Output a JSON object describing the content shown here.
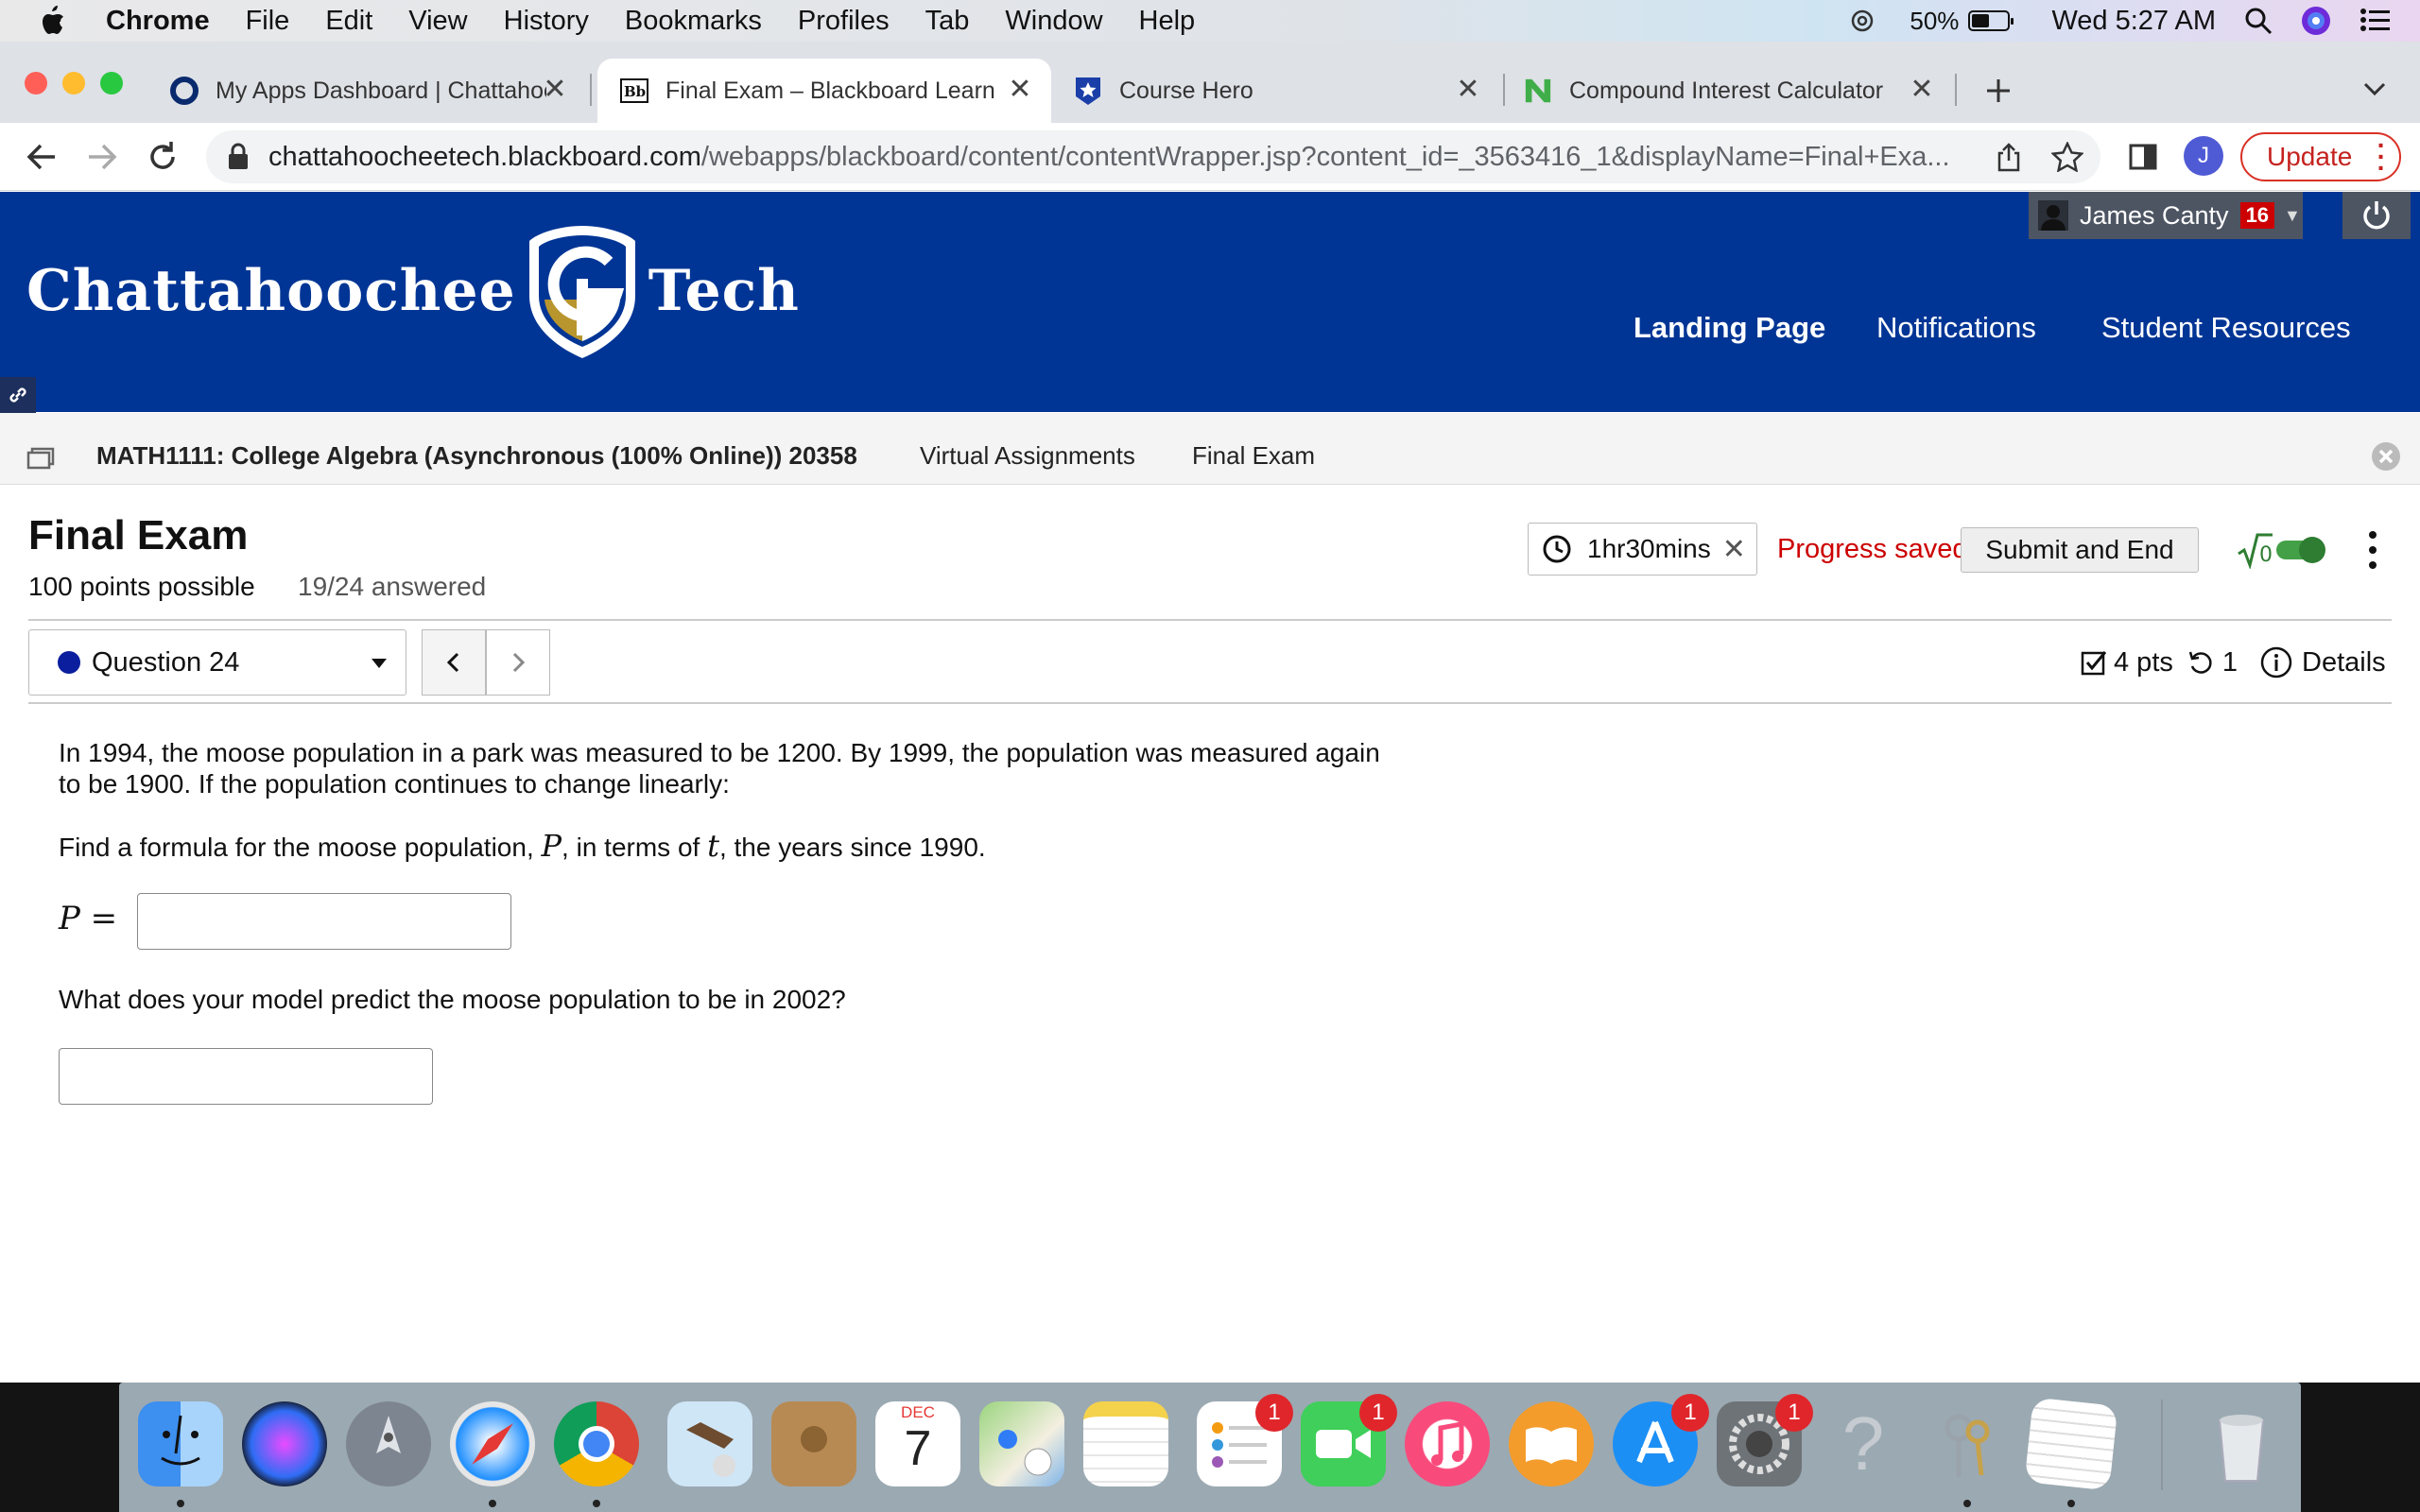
{
  "menubar": {
    "app": "Chrome",
    "items": [
      "File",
      "Edit",
      "View",
      "History",
      "Bookmarks",
      "Profiles",
      "Tab",
      "Window",
      "Help"
    ],
    "battery": "50%",
    "battery_level": 0.5,
    "clock": "Wed 5:27 AM"
  },
  "tabs": [
    {
      "title": "My Apps Dashboard | Chattahoochee Tech",
      "favicon": "circle-o-icon",
      "active": false
    },
    {
      "title": "Final Exam – Blackboard Learn",
      "favicon": "blackboard-bb-icon",
      "active": true
    },
    {
      "title": "Course Hero",
      "favicon": "course-hero-star-icon",
      "active": false
    },
    {
      "title": "Compound Interest Calculator",
      "favicon": "nerdwallet-n-icon",
      "active": false
    }
  ],
  "address": {
    "host": "chattahoocheetech.blackboard.com",
    "path": "/webapps/blackboard/content/contentWrapper.jsp?content_id=_3563416_1&displayName=Final+Exa...",
    "profile_initial": "J",
    "update_label": "Update"
  },
  "header": {
    "logo_left": "Chattahoochee",
    "logo_right": "Tech",
    "user_name": "James Canty",
    "notification_count": "16",
    "nav": [
      "Landing Page",
      "Notifications",
      "Student Resources"
    ]
  },
  "breadcrumb": {
    "course": "MATH1111: College Algebra (Asynchronous (100% Online)) 20358",
    "section": "Virtual Assignments",
    "page": "Final Exam"
  },
  "exam": {
    "title": "Final Exam",
    "points_possible": "100 points possible",
    "answered": "19/24 answered",
    "timer": "1hr30mins",
    "progress": "Progress saved",
    "submit_label": "Submit and End",
    "question_label": "Question 24",
    "points": "4 pts",
    "attempts": "1",
    "details_label": "Details"
  },
  "question": {
    "intro": "In 1994, the moose population in a park was measured to be 1200. By 1999, the population was measured again to be 1900. If the population continues to change linearly:",
    "prompt_a_pre": "Find a formula for the moose population, ",
    "prompt_a_var1": "P",
    "prompt_a_mid": ", in terms of ",
    "prompt_a_var2": "t",
    "prompt_a_post": ", the years since 1990.",
    "answer_label": "P =",
    "prompt_b": "What does your model predict the moose population to be in 2002?"
  },
  "dock": {
    "apps": [
      "finder-icon",
      "siri-icon",
      "launchpad-icon",
      "safari-icon",
      "chrome-icon",
      "mail-icon",
      "contacts-icon",
      "calendar-icon",
      "maps-icon",
      "notes-icon",
      "reminders-icon",
      "facetime-icon",
      "music-icon",
      "books-icon",
      "app-store-icon",
      "system-preferences-icon",
      "help-icon",
      "keychain-icon",
      "textedit-icon",
      "trash-icon"
    ],
    "calendar_month": "DEC",
    "calendar_day": "7",
    "badge": "1"
  }
}
